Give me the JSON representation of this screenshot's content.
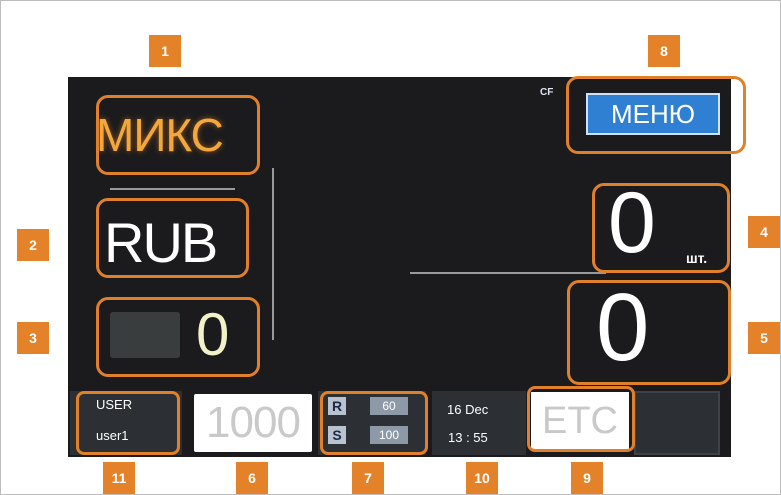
{
  "callouts": [
    "1",
    "2",
    "3",
    "4",
    "5",
    "6",
    "7",
    "8",
    "9",
    "10",
    "11"
  ],
  "display": {
    "mode": "МИКС",
    "currency": "RUB",
    "accumulated_value": "0",
    "cf_indicator": "CF",
    "menu_label": "МЕНЮ",
    "count": "0",
    "count_unit": "шт.",
    "total": "0"
  },
  "bottom_bar": {
    "user_label": "USER",
    "user_value": "user1",
    "denomination": "1000",
    "r_label": "R",
    "r_value": "60",
    "s_label": "S",
    "s_value": "100",
    "date": "16 Dec",
    "time": "13 : 55",
    "etc_label": "ETC"
  },
  "colors": {
    "callout": "#e4822a",
    "highlight_outline": "#e0802a",
    "screen_bg": "#1b1b1d",
    "menu_button": "#2f7fd3",
    "mode_text": "#f2a83c"
  }
}
